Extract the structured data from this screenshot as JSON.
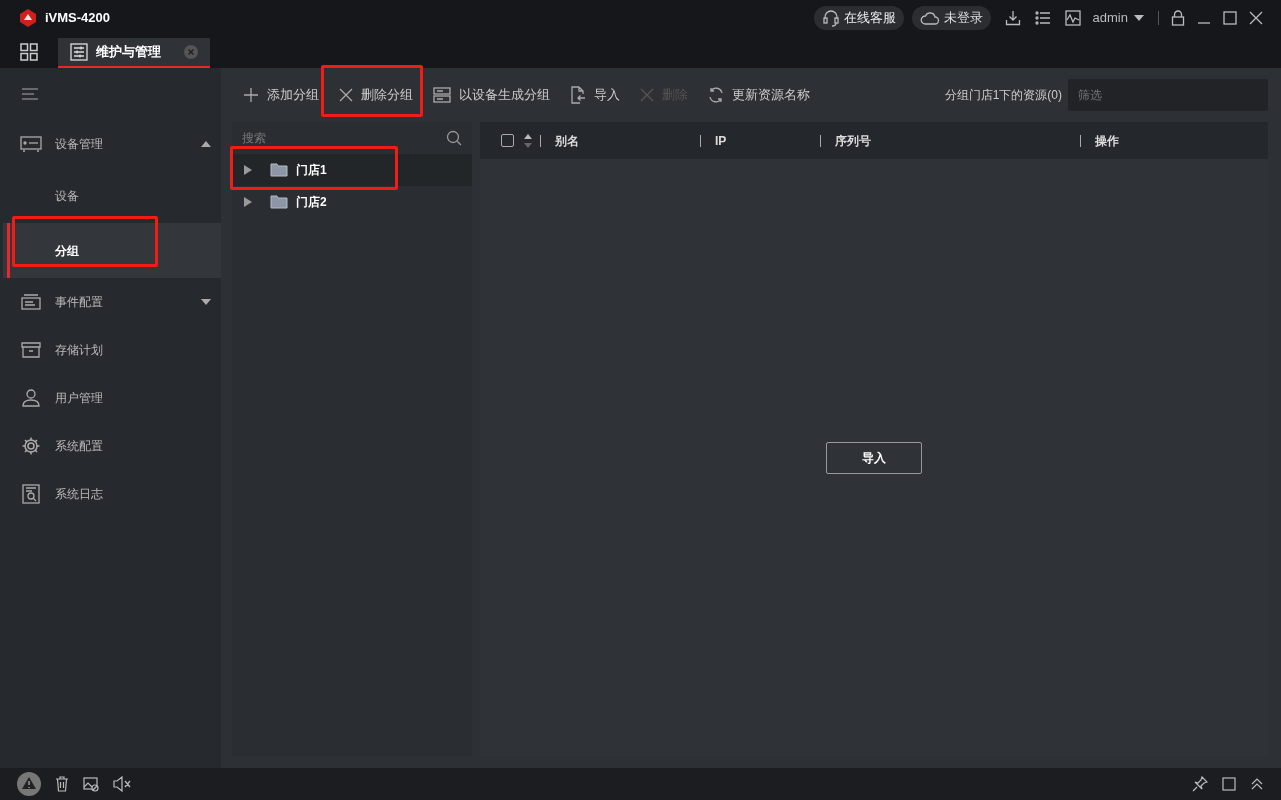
{
  "window": {
    "title": "iVMS-4200"
  },
  "top_actions": {
    "service": "在线客服",
    "login": "未登录",
    "user": "admin"
  },
  "tabs": [
    {
      "label": "维护与管理",
      "selected": true
    }
  ],
  "sidebar": {
    "items": [
      {
        "kind": "group",
        "label": "设备管理",
        "expanded": true,
        "selected": false,
        "highlighted": false
      },
      {
        "kind": "sub",
        "label": "设备",
        "selected": false,
        "highlighted": false
      },
      {
        "kind": "sub",
        "label": "分组",
        "selected": true,
        "highlighted": true
      },
      {
        "kind": "group",
        "label": "事件配置",
        "expanded": false,
        "selected": false,
        "highlighted": false
      },
      {
        "kind": "item",
        "label": "存储计划",
        "selected": false,
        "highlighted": false
      },
      {
        "kind": "item",
        "label": "用户管理",
        "selected": false,
        "highlighted": false
      },
      {
        "kind": "item",
        "label": "系统配置",
        "selected": false,
        "highlighted": false
      },
      {
        "kind": "item",
        "label": "系统日志",
        "selected": false,
        "highlighted": false
      }
    ]
  },
  "toolbar": [
    {
      "kind": "add",
      "label": "添加分组",
      "disabled": false,
      "highlighted": false
    },
    {
      "kind": "delete",
      "label": "删除分组",
      "disabled": false,
      "highlighted": true
    },
    {
      "kind": "device",
      "label": "以设备生成分组",
      "disabled": false,
      "highlighted": false
    },
    {
      "kind": "import",
      "label": "导入",
      "disabled": false,
      "highlighted": false
    },
    {
      "kind": "delete",
      "label": "删除",
      "disabled": true,
      "highlighted": false
    },
    {
      "kind": "refresh",
      "label": "更新资源名称",
      "disabled": false,
      "highlighted": false
    }
  ],
  "resource_label": "分组门店1下的资源(0)",
  "filter": {
    "placeholder": "筛选"
  },
  "tree": {
    "search_placeholder": "搜索",
    "nodes": [
      {
        "label": "门店1",
        "selected": true,
        "highlighted": true
      },
      {
        "label": "门店2",
        "selected": false,
        "highlighted": false
      }
    ]
  },
  "table": {
    "all_checked": false,
    "columns": [
      "别名",
      "IP",
      "序列号",
      "操作"
    ],
    "empty_button": "导入"
  }
}
